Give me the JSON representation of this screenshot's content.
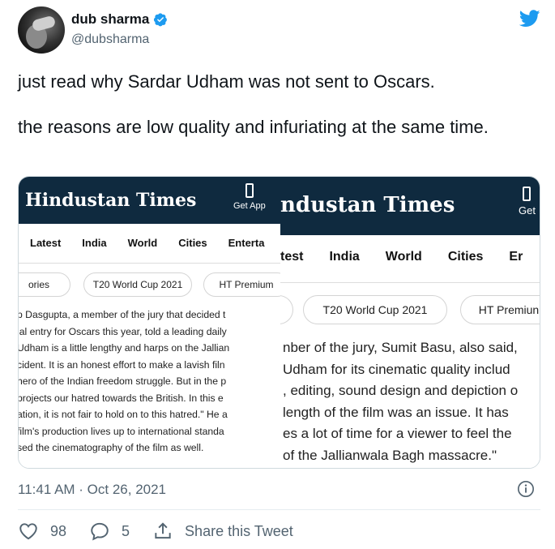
{
  "user": {
    "name": "dub sharma",
    "handle": "@dubsharma"
  },
  "tweet": {
    "paragraphs": [
      "just read why Sardar Udham was not sent to Oscars.",
      "the reasons are low quality and infuriating at the same time."
    ],
    "timestamp": "11:41 AM · Oct 26, 2021"
  },
  "media": {
    "left": {
      "logo": "Hindustan Times",
      "get_app": "Get App",
      "nav": [
        "Latest",
        "India",
        "World",
        "Cities",
        "Enterta"
      ],
      "pills": [
        "ories",
        "T20 World Cup 2021",
        "HT Premium"
      ],
      "lines": [
        "p Dasgupta, a member of the jury that decided t",
        "ial entry for Oscars this year, told a leading daily",
        "Udham is a little lengthy and harps on the Jallian",
        "cident. It is an honest effort to make a lavish filn",
        "hero of the Indian freedom struggle. But in the p",
        "projects our hatred towards the British. In this e",
        "ation, it is not fair to hold on to this hatred.\" He a",
        "film's production lives up to international standa",
        "sed the cinematography of the film as well."
      ]
    },
    "right": {
      "logo": "ndustan Times",
      "get_app": "Get",
      "nav": [
        "test",
        "India",
        "World",
        "Cities",
        "Er"
      ],
      "pills": [
        "T20 World Cup 2021",
        "HT Premiun"
      ],
      "lines": [
        "nber of the jury, Sumit Basu, also said,",
        " Udham for its cinematic quality includ",
        ", editing, sound design and depiction o",
        " length of the film was an issue. It has",
        "es a lot of time for a viewer to feel the",
        "of the Jallianwala Bagh massacre.\""
      ]
    }
  },
  "actions": {
    "likes": "98",
    "replies": "5",
    "share_label": "Share this Tweet"
  },
  "icons": {
    "verified": "verified-badge-icon",
    "twitter": "twitter-bird-icon",
    "info": "info-icon",
    "like": "heart-icon",
    "reply": "reply-icon",
    "share": "share-icon"
  },
  "colors": {
    "twitter_blue": "#1d9bf0",
    "ht_bar": "#0f2a3f",
    "muted": "#536471"
  }
}
